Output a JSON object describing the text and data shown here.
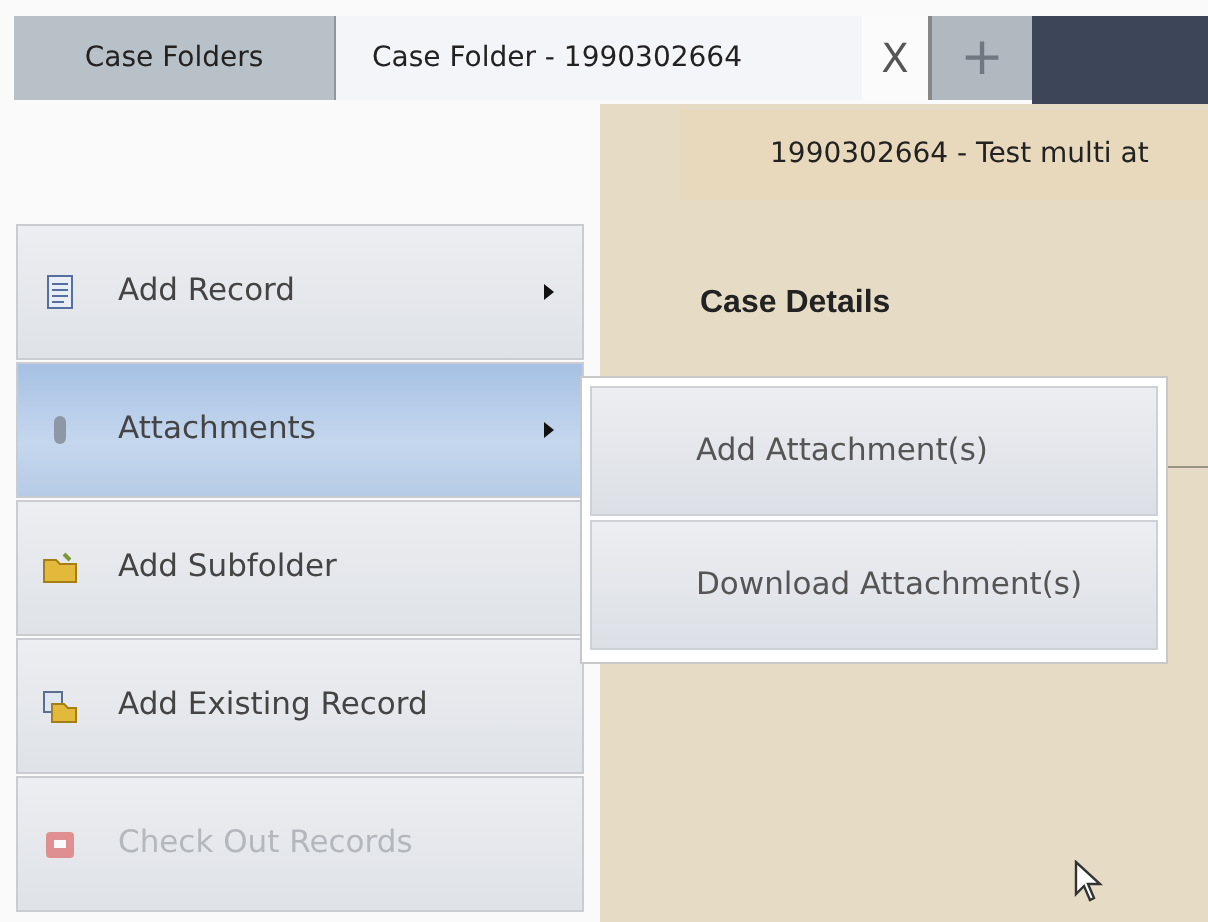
{
  "tabs": [
    {
      "label": "Case Folders",
      "selected": false
    },
    {
      "label": "Case Folder - 1990302664",
      "selected": true
    }
  ],
  "close_tab": "X",
  "new_tab": "+",
  "panel": {
    "title": "1990302664 - Test multi at",
    "section": "Case Details"
  },
  "menu": [
    {
      "kind": "record",
      "label": "Add Record",
      "submenu": true,
      "selected": false,
      "disabled": false
    },
    {
      "kind": "attachment",
      "label": "Attachments",
      "submenu": true,
      "selected": true,
      "disabled": false
    },
    {
      "kind": "folder",
      "label": "Add Subfolder",
      "submenu": false,
      "selected": false,
      "disabled": false
    },
    {
      "kind": "existing",
      "label": "Add Existing Record",
      "submenu": false,
      "selected": false,
      "disabled": false
    },
    {
      "kind": "checkout",
      "label": "Check Out Records",
      "submenu": false,
      "selected": false,
      "disabled": true
    }
  ],
  "submenu": [
    {
      "label": "Add Attachment(s)"
    },
    {
      "label": "Download Attachment(s)"
    }
  ]
}
